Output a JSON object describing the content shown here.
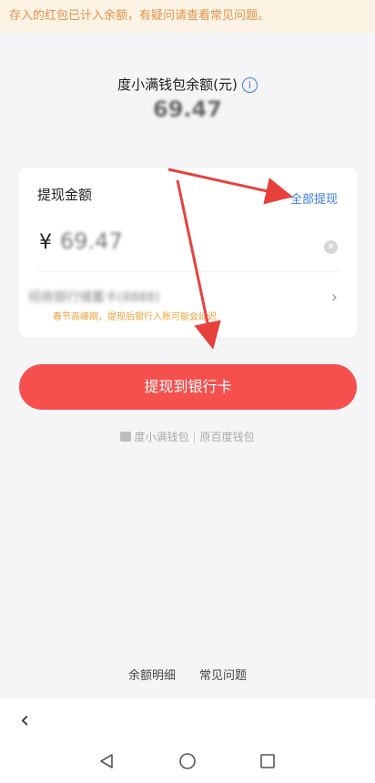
{
  "notice": "存入的红包已计入余额，有疑问请查看常见问题。",
  "balance": {
    "title": "度小满钱包余额(元)",
    "info_icon": "info-icon",
    "amount": "69.47"
  },
  "withdraw": {
    "label": "提现金额",
    "withdraw_all": "全部提现",
    "currency": "¥",
    "amount_value": "69.47",
    "clear_icon": "clear-icon",
    "bank_name": "招商银行储蓄卡(8888)",
    "chevron_icon": "chevron-right-icon",
    "hint": "春节高峰期，提现后银行入账可能会延迟"
  },
  "cta": "提现到银行卡",
  "brand": {
    "logo_icon": "wallet-logo-icon",
    "name": "度小满钱包",
    "separator": "|",
    "formerly": "原百度钱包"
  },
  "footer": {
    "balance_detail": "余额明细",
    "faq": "常见问题"
  },
  "nav": {
    "back_icon": "back-arrow-icon",
    "system_buttons": [
      "back-triangle-icon",
      "home-circle-icon",
      "recents-square-icon"
    ]
  },
  "colors": {
    "accent_red": "#f5504e",
    "link_blue": "#3b7bea",
    "notice_bg": "#fdf3e4",
    "notice_text": "#e8924a",
    "hint_orange": "#f0a23c",
    "annotation_arrow": "#e8413c"
  }
}
